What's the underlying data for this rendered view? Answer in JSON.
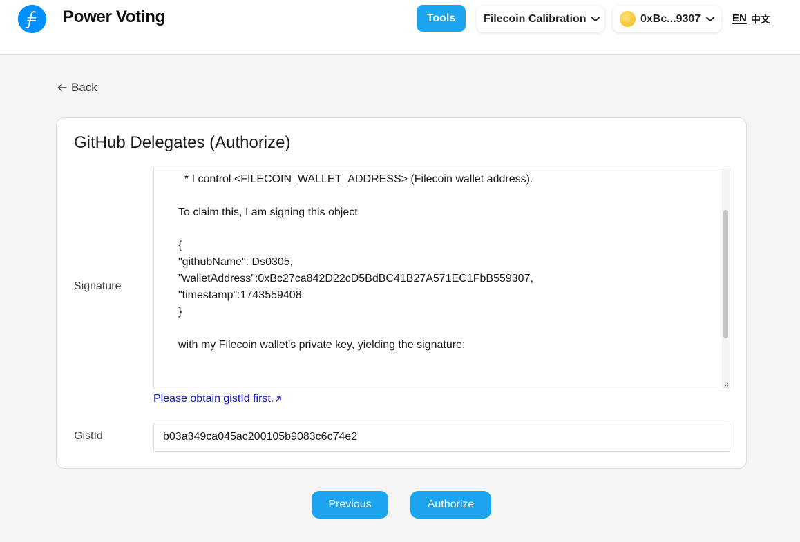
{
  "header": {
    "brand": "Power Voting",
    "tools_label": "Tools",
    "network_label": "Filecoin Calibration",
    "wallet_label": "0xBc...9307",
    "lang_en": "EN",
    "lang_zh": "中文"
  },
  "nav": {
    "back_label": "Back"
  },
  "card": {
    "title": "GitHub Delegates (Authorize)",
    "signature_label": "Signature",
    "signature_lines": [
      "  * I control <FILECOIN_WALLET_ADDRESS> (Filecoin wallet address).",
      "",
      "To claim this, I am signing this object",
      "",
      "{",
      "\"githubName\": Ds0305,",
      "\"walletAddress\":0xBc27ca842D22cD5BdBC41B27A571EC1FbB559307,",
      "\"timestamp\":1743559408",
      "}",
      "",
      "with my Filecoin wallet's private key, yielding the signature:"
    ],
    "gist_link_label": "Please obtain gistId first.",
    "gistid_label": "GistId",
    "gistid_value": "b03a349ca045ac200105b9083c6c74e2"
  },
  "actions": {
    "previous_label": "Previous",
    "authorize_label": "Authorize"
  },
  "colors": {
    "accent": "#1ca5ee",
    "logo": "#0090ff",
    "link": "#1010d0"
  }
}
